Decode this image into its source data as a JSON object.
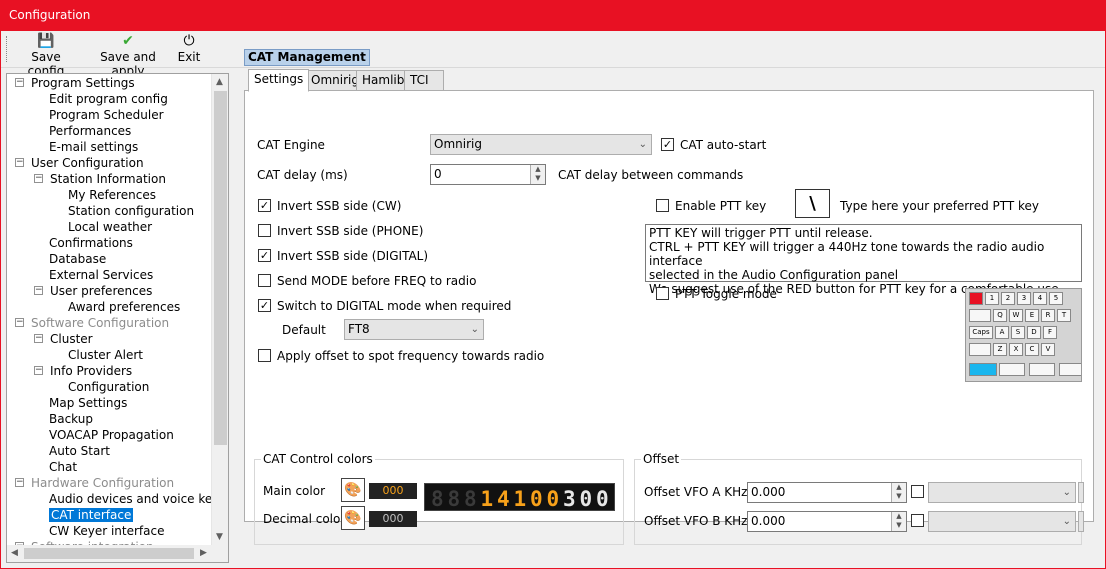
{
  "window": {
    "title": "Configuration"
  },
  "toolbar": {
    "save_config": "Save config",
    "save_apply": "Save and apply",
    "exit": "Exit"
  },
  "tree": [
    {
      "label": "Program Settings",
      "level": 0,
      "exp": "-",
      "dim": false
    },
    {
      "label": "Edit program config",
      "level": 1,
      "dim": false
    },
    {
      "label": "Program Scheduler",
      "level": 1,
      "dim": false
    },
    {
      "label": "Performances",
      "level": 1,
      "dim": false
    },
    {
      "label": "E-mail settings",
      "level": 1,
      "dim": false
    },
    {
      "label": "User Configuration",
      "level": 0,
      "exp": "-",
      "dim": false
    },
    {
      "label": "Station Information",
      "level": 1,
      "exp": "-",
      "dim": false
    },
    {
      "label": "My References",
      "level": 2,
      "dim": false
    },
    {
      "label": "Station configuration",
      "level": 2,
      "dim": false
    },
    {
      "label": "Local weather",
      "level": 2,
      "dim": false
    },
    {
      "label": "Confirmations",
      "level": 1,
      "dim": false
    },
    {
      "label": "Database",
      "level": 1,
      "dim": false
    },
    {
      "label": "External Services",
      "level": 1,
      "dim": false
    },
    {
      "label": "User preferences",
      "level": 1,
      "exp": "-",
      "dim": false
    },
    {
      "label": "Award preferences",
      "level": 2,
      "dim": false
    },
    {
      "label": "Software Configuration",
      "level": 0,
      "exp": "-",
      "dim": true
    },
    {
      "label": "Cluster",
      "level": 1,
      "exp": "-",
      "dim": false
    },
    {
      "label": "Cluster Alert",
      "level": 2,
      "dim": false
    },
    {
      "label": "Info Providers",
      "level": 1,
      "exp": "-",
      "dim": false
    },
    {
      "label": "Configuration",
      "level": 2,
      "dim": false
    },
    {
      "label": "Map Settings",
      "level": 1,
      "dim": false
    },
    {
      "label": "Backup",
      "level": 1,
      "dim": false
    },
    {
      "label": "VOACAP Propagation",
      "level": 1,
      "dim": false
    },
    {
      "label": "Auto Start",
      "level": 1,
      "dim": false
    },
    {
      "label": "Chat",
      "level": 1,
      "dim": false
    },
    {
      "label": "Hardware Configuration",
      "level": 0,
      "exp": "-",
      "dim": true
    },
    {
      "label": "Audio devices and voice keye",
      "level": 1,
      "dim": false
    },
    {
      "label": "CAT interface",
      "level": 1,
      "dim": false,
      "selected": true
    },
    {
      "label": "CW Keyer interface",
      "level": 1,
      "dim": false
    },
    {
      "label": "Software integration",
      "level": 0,
      "exp": "-",
      "dim": true
    }
  ],
  "section": {
    "title": "CAT Management"
  },
  "tabs": [
    "Settings",
    "Omnirig",
    "Hamlib",
    "TCI"
  ],
  "settings": {
    "cat_engine_label": "CAT Engine",
    "cat_engine_value": "Omnirig",
    "cat_autostart": "CAT auto-start",
    "cat_delay_label": "CAT delay (ms)",
    "cat_delay_value": "0",
    "cat_delay_hint": "CAT delay between commands",
    "invert_cw": "Invert SSB side (CW)",
    "invert_phone": "Invert SSB side (PHONE)",
    "invert_digital": "Invert SSB side (DIGITAL)",
    "send_mode": "Send MODE before FREQ to radio",
    "switch_digital": "Switch to DIGITAL mode when required",
    "default_label": "Default",
    "default_value": "FT8",
    "apply_offset": "Apply offset to spot frequency towards radio",
    "enable_ptt": "Enable PTT key",
    "ptt_key_value": "\\",
    "ptt_key_hint": "Type here your preferred PTT key",
    "ptt_info": [
      "PTT KEY will trigger PTT until release.",
      "CTRL + PTT KEY will trigger a 440Hz tone towards the radio audio interface",
      "selected in the Audio Configuration panel",
      "We suggest use of the RED button for PTT key for a comfortable use"
    ],
    "ptt_toggle": "PTT Toggle mode"
  },
  "checks": {
    "cat_autostart": true,
    "invert_cw": true,
    "invert_phone": false,
    "invert_digital": true,
    "send_mode": false,
    "switch_digital": true,
    "apply_offset": false,
    "enable_ptt": false,
    "ptt_toggle": false,
    "offset_a": false,
    "offset_b": false
  },
  "colors_group": {
    "title": "CAT Control colors",
    "main_label": "Main color",
    "main_value": "000",
    "decimal_label": "Decimal color",
    "decimal_value": "000",
    "display_digits": [
      "8",
      "8",
      "8",
      "1",
      "4",
      "1",
      "0",
      "0",
      "3",
      "0",
      "0"
    ],
    "main_hex": "#f7a11a",
    "decimal_hex": "#e6e6e6",
    "dim_hex": "#3a3a3a"
  },
  "offset_group": {
    "title": "Offset",
    "vfo_a_label": "Offset VFO A KHz",
    "vfo_a_value": "0.000",
    "vfo_b_label": "Offset VFO B KHz",
    "vfo_b_value": "0.000"
  },
  "keyboard": {
    "row1": [
      "",
      "1",
      "2",
      "3",
      "4",
      "5"
    ],
    "row2": [
      "",
      "Q",
      "W",
      "E",
      "R",
      "T"
    ],
    "row3": [
      "Caps",
      "A",
      "S",
      "D",
      "F"
    ],
    "row4": [
      "",
      "Z",
      "X",
      "C",
      "V"
    ],
    "red": "#e81123",
    "blue": "#19b6ee"
  },
  "icons": {
    "save": "💾",
    "check": "✔",
    "power": "⏻"
  }
}
